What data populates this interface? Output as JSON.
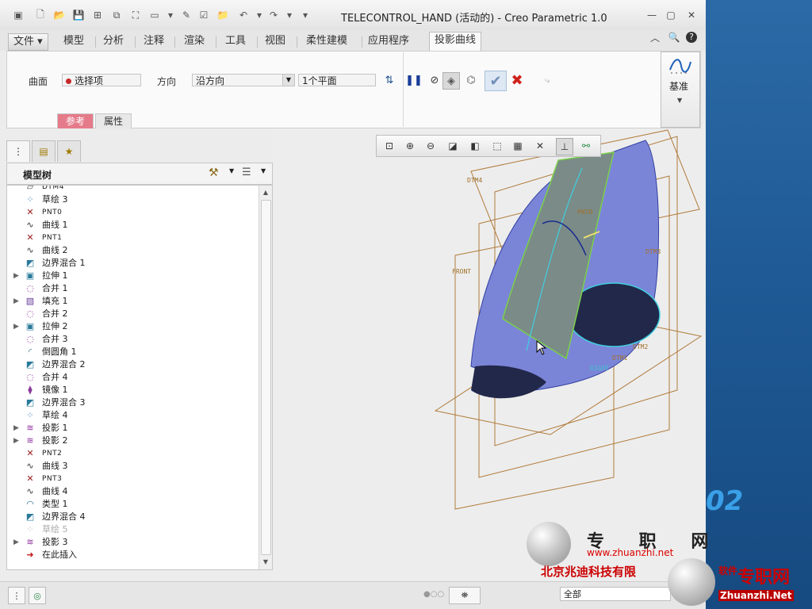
{
  "window": {
    "title": "TELECONTROL_HAND (活动的) - Creo Parametric 1.0"
  },
  "quick_access": {
    "icons": [
      "new-icon",
      "open-icon",
      "save-icon",
      "regenerate-icon",
      "window-icon",
      "undo-icon",
      "redo-icon",
      "customize-icon"
    ]
  },
  "tabs": {
    "file": "文件",
    "items": [
      "模型",
      "分析",
      "注释",
      "渲染",
      "工具",
      "视图",
      "柔性建模",
      "应用程序"
    ],
    "active": "投影曲线"
  },
  "ribbon": {
    "surface_label": "曲面",
    "surface_value": "选择项",
    "direction_label": "方向",
    "direction_value": "沿方向",
    "plane_value": "1个平面",
    "subtabs": [
      "参考",
      "属性"
    ],
    "datum_label": "基准"
  },
  "model_tree": {
    "title": "模型树",
    "items": [
      {
        "icon": "▱",
        "label": "DTM4",
        "type": "datum"
      },
      {
        "icon": "⁘",
        "label": "草绘 3",
        "type": "sketch"
      },
      {
        "icon": "✕",
        "label": "PNT0",
        "type": "point"
      },
      {
        "icon": "∿",
        "label": "曲线 1",
        "type": "curve"
      },
      {
        "icon": "✕",
        "label": "PNT1",
        "type": "point"
      },
      {
        "icon": "∿",
        "label": "曲线 2",
        "type": "curve"
      },
      {
        "icon": "◩",
        "label": "边界混合 1",
        "type": "blend"
      },
      {
        "icon": "▣",
        "label": "拉伸 1",
        "type": "extrude",
        "expandable": true
      },
      {
        "icon": "◌",
        "label": "合并 1",
        "type": "merge"
      },
      {
        "icon": "▧",
        "label": "填充 1",
        "type": "fill",
        "expandable": true
      },
      {
        "icon": "◌",
        "label": "合并 2",
        "type": "merge"
      },
      {
        "icon": "▣",
        "label": "拉伸 2",
        "type": "extrude",
        "expandable": true
      },
      {
        "icon": "◌",
        "label": "合并 3",
        "type": "merge"
      },
      {
        "icon": "◜",
        "label": "倒圆角 1",
        "type": "round"
      },
      {
        "icon": "◩",
        "label": "边界混合 2",
        "type": "blend"
      },
      {
        "icon": "◌",
        "label": "合并 4",
        "type": "merge"
      },
      {
        "icon": "⧫",
        "label": "镜像 1",
        "type": "mirror"
      },
      {
        "icon": "◩",
        "label": "边界混合 3",
        "type": "blend"
      },
      {
        "icon": "⁘",
        "label": "草绘 4",
        "type": "sketch"
      },
      {
        "icon": "≋",
        "label": "投影 1",
        "type": "project",
        "expandable": true
      },
      {
        "icon": "≋",
        "label": "投影 2",
        "type": "project",
        "expandable": true
      },
      {
        "icon": "✕",
        "label": "PNT2",
        "type": "point"
      },
      {
        "icon": "∿",
        "label": "曲线 3",
        "type": "curve"
      },
      {
        "icon": "✕",
        "label": "PNT3",
        "type": "point"
      },
      {
        "icon": "∿",
        "label": "曲线 4",
        "type": "curve"
      },
      {
        "icon": "◠",
        "label": "类型 1",
        "type": "style"
      },
      {
        "icon": "◩",
        "label": "边界混合 4",
        "type": "blend"
      },
      {
        "icon": "⁘",
        "label": "草绘 5",
        "type": "sketch",
        "dim": true
      },
      {
        "icon": "≋",
        "label": "投影 3",
        "type": "project",
        "expandable": true
      },
      {
        "icon": "➜",
        "label": "在此插入",
        "type": "insert"
      }
    ]
  },
  "graphics": {
    "datum_labels": [
      "DTM4",
      "PNT0",
      "DTM3",
      "FRONT",
      "DTM1",
      "DTM2",
      "RIGHT"
    ]
  },
  "status": {
    "filter_value": "全部"
  },
  "watermark": {
    "site_cn": "专 职 网",
    "url": "www.zhuanzhi.net",
    "company": "北京兆迪科技有限",
    "side_a": "软件",
    "site_cn2": "专职网",
    "url2": "Zhuanzhi.Net"
  },
  "desktop": {
    "deco": "02"
  },
  "colors": {
    "accent": "#3c5aa8",
    "surface": "#7b85d8",
    "datum": "#b07a3a",
    "highlight": "#7ad04a",
    "subtab_active": "#e57b8a"
  }
}
